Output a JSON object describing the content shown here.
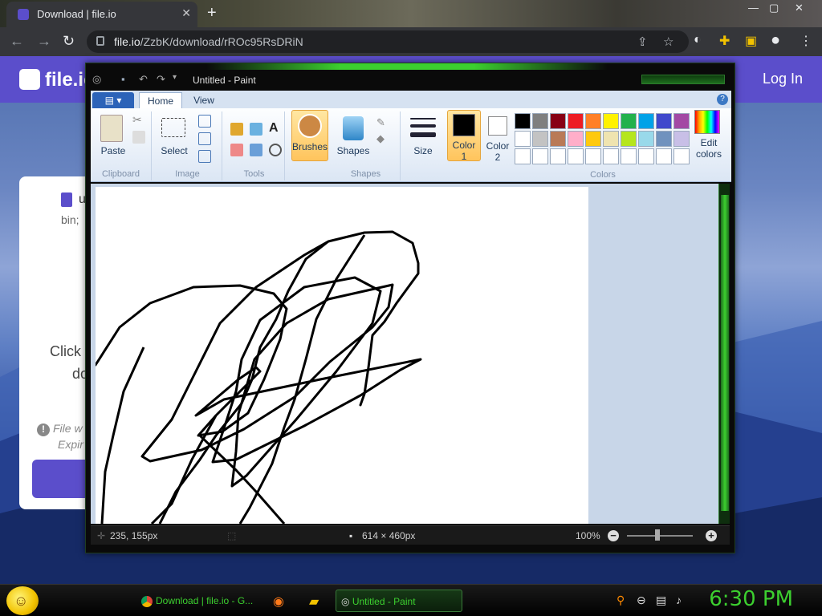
{
  "browser": {
    "tab_title": "Download | file.io",
    "tab_close": "✕",
    "new_tab": "+",
    "url_host": "file.io",
    "url_path": "/ZzbK/download/rROc95RsDRiN"
  },
  "page": {
    "brand": "file.io",
    "login": "Log In",
    "file_name": "u",
    "file_meta": "bin;",
    "click_text_1": "Click",
    "click_text_2": "do",
    "warn_glyph": "!",
    "warn_line_1": "File w",
    "warn_line_2": "Expir"
  },
  "paint": {
    "title": "Untitled - Paint",
    "tabs": [
      "Home",
      "View"
    ],
    "groups": {
      "clipboard": "Clipboard",
      "image": "Image",
      "tools": "Tools",
      "shapes": "Shapes",
      "colors": "Colors"
    },
    "buttons": {
      "paste": "Paste",
      "select": "Select",
      "brushes": "Brushes",
      "shapes": "Shapes",
      "size": "Size",
      "color1_a": "Color",
      "color1_b": "1",
      "color2_a": "Color",
      "color2_b": "2",
      "edit_colors_a": "Edit",
      "edit_colors_b": "colors"
    },
    "palette_colors": [
      "#000000",
      "#7f7f7f",
      "#880015",
      "#ed1c24",
      "#ff7f27",
      "#fff200",
      "#22b14c",
      "#00a2e8",
      "#3f48cc",
      "#a349a4",
      "#ffffff",
      "#c3c3c3",
      "#b97a57",
      "#ffaec9",
      "#ffc90e",
      "#efe4b0",
      "#b5e61d",
      "#99d9ea",
      "#7092be",
      "#c8bfe7",
      "#ffffff",
      "#ffffff",
      "#ffffff",
      "#ffffff",
      "#ffffff",
      "#ffffff",
      "#ffffff",
      "#ffffff",
      "#ffffff",
      "#ffffff"
    ],
    "status": {
      "cursor_pos": "235, 155px",
      "canvas_size": "614 × 460px",
      "zoom": "100%"
    }
  },
  "taskbar": {
    "items": [
      "Download | file.io - G...",
      "Untitled - Paint"
    ],
    "clock": "6:30 PM"
  },
  "colors": {
    "accent_purple": "#5b4ecb",
    "theme_green": "#3ccf2f"
  }
}
